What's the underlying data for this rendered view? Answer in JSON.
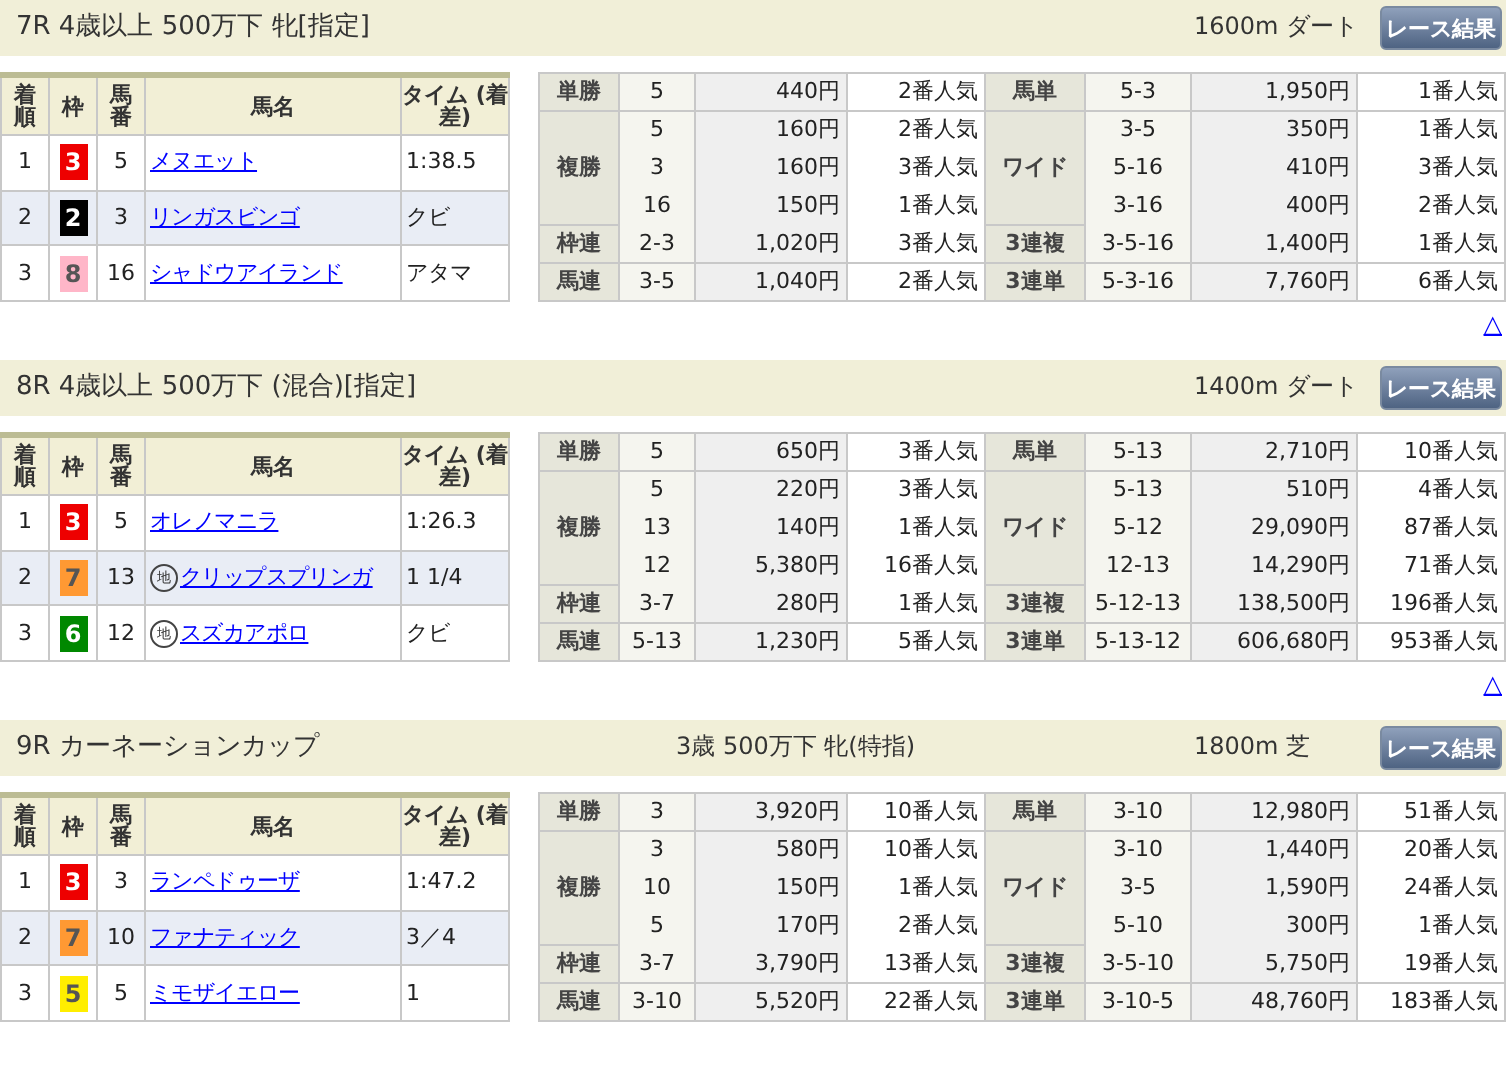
{
  "races": [
    {
      "title": "7R 4歳以上 500万下 牝[指定]",
      "course": "1600m ダート",
      "button": "レース結果",
      "columns": [
        "着順",
        "枠",
        "馬番",
        "馬名",
        "タイム (着差)"
      ],
      "results": [
        {
          "place": "1",
          "waku": "3",
          "color": "#ee0000",
          "number": "5",
          "name": "メヌエット",
          "time": "1:38.5"
        },
        {
          "place": "2",
          "waku": "2",
          "color": "#000000",
          "number": "3",
          "name": "リンガスビンゴ",
          "time": "クビ"
        },
        {
          "place": "3",
          "waku": "8",
          "color": "#ffb6c8",
          "number": "16",
          "name": "シャドウアイランド",
          "time": "アタマ"
        }
      ],
      "payouts_left": [
        {
          "label": "単勝",
          "entries": [
            {
              "combo": "5",
              "amount": "440円",
              "popularity": "2番人気"
            }
          ]
        },
        {
          "label": "複勝",
          "entries": [
            {
              "combo": "5",
              "amount": "160円",
              "popularity": "2番人気"
            },
            {
              "combo": "3",
              "amount": "160円",
              "popularity": "3番人気"
            },
            {
              "combo": "16",
              "amount": "150円",
              "popularity": "1番人気"
            }
          ]
        },
        {
          "label": "枠連",
          "entries": [
            {
              "combo": "2-3",
              "amount": "1,020円",
              "popularity": "3番人気"
            }
          ]
        },
        {
          "label": "馬連",
          "entries": [
            {
              "combo": "3-5",
              "amount": "1,040円",
              "popularity": "2番人気"
            }
          ]
        }
      ],
      "payouts_right": [
        {
          "label": "馬単",
          "entries": [
            {
              "combo": "5-3",
              "amount": "1,950円",
              "popularity": "1番人気"
            }
          ]
        },
        {
          "label": "ワイド",
          "entries": [
            {
              "combo": "3-5",
              "amount": "350円",
              "popularity": "1番人気"
            },
            {
              "combo": "5-16",
              "amount": "410円",
              "popularity": "3番人気"
            },
            {
              "combo": "3-16",
              "amount": "400円",
              "popularity": "2番人気"
            }
          ]
        },
        {
          "label": "3連複",
          "entries": [
            {
              "combo": "3-5-16",
              "amount": "1,400円",
              "popularity": "1番人気"
            }
          ]
        },
        {
          "label": "3連単",
          "entries": [
            {
              "combo": "5-3-16",
              "amount": "7,760円",
              "popularity": "6番人気"
            }
          ]
        }
      ],
      "back_link": "△"
    },
    {
      "title": "8R 4歳以上 500万下 (混合)[指定]",
      "course": "1400m ダート",
      "button": "レース結果",
      "columns": [
        "着順",
        "枠",
        "馬番",
        "馬名",
        "タイム (着差)"
      ],
      "results": [
        {
          "place": "1",
          "waku": "3",
          "color": "#ee0000",
          "number": "5",
          "name": "オレノマニラ",
          "time": "1:26.3"
        },
        {
          "place": "2",
          "waku": "7",
          "color": "#ff9933",
          "number": "13",
          "marker": "地",
          "name": "クリップスプリンガ",
          "time": "1 1/4"
        },
        {
          "place": "3",
          "waku": "6",
          "color": "#008800",
          "number": "12",
          "marker": "地",
          "name": "スズカアポロ",
          "time": "クビ"
        }
      ],
      "payouts_left": [
        {
          "label": "単勝",
          "entries": [
            {
              "combo": "5",
              "amount": "650円",
              "popularity": "3番人気"
            }
          ]
        },
        {
          "label": "複勝",
          "entries": [
            {
              "combo": "5",
              "amount": "220円",
              "popularity": "3番人気"
            },
            {
              "combo": "13",
              "amount": "140円",
              "popularity": "1番人気"
            },
            {
              "combo": "12",
              "amount": "5,380円",
              "popularity": "16番人気"
            }
          ]
        },
        {
          "label": "枠連",
          "entries": [
            {
              "combo": "3-7",
              "amount": "280円",
              "popularity": "1番人気"
            }
          ]
        },
        {
          "label": "馬連",
          "entries": [
            {
              "combo": "5-13",
              "amount": "1,230円",
              "popularity": "5番人気"
            }
          ]
        }
      ],
      "payouts_right": [
        {
          "label": "馬単",
          "entries": [
            {
              "combo": "5-13",
              "amount": "2,710円",
              "popularity": "10番人気"
            }
          ]
        },
        {
          "label": "ワイド",
          "entries": [
            {
              "combo": "5-13",
              "amount": "510円",
              "popularity": "4番人気"
            },
            {
              "combo": "5-12",
              "amount": "29,090円",
              "popularity": "87番人気"
            },
            {
              "combo": "12-13",
              "amount": "14,290円",
              "popularity": "71番人気"
            }
          ]
        },
        {
          "label": "3連複",
          "entries": [
            {
              "combo": "5-12-13",
              "amount": "138,500円",
              "popularity": "196番人気"
            }
          ]
        },
        {
          "label": "3連単",
          "entries": [
            {
              "combo": "5-13-12",
              "amount": "606,680円",
              "popularity": "953番人気"
            }
          ]
        }
      ],
      "back_link": "△"
    },
    {
      "title": "9R カーネーションカップ",
      "subtitle": "3歳 500万下 牝(特指)",
      "course": "1800m 芝",
      "button": "レース結果",
      "columns": [
        "着順",
        "枠",
        "馬番",
        "馬名",
        "タイム (着差)"
      ],
      "results": [
        {
          "place": "1",
          "waku": "3",
          "color": "#ee0000",
          "number": "3",
          "name": "ランペドゥーザ",
          "time": "1:47.2"
        },
        {
          "place": "2",
          "waku": "7",
          "color": "#ff9933",
          "number": "10",
          "name": "ファナティック",
          "time": "3／4"
        },
        {
          "place": "3",
          "waku": "5",
          "color": "#ffee00",
          "number": "5",
          "name": "ミモザイエロー",
          "time": "1"
        }
      ],
      "payouts_left": [
        {
          "label": "単勝",
          "entries": [
            {
              "combo": "3",
              "amount": "3,920円",
              "popularity": "10番人気"
            }
          ]
        },
        {
          "label": "複勝",
          "entries": [
            {
              "combo": "3",
              "amount": "580円",
              "popularity": "10番人気"
            },
            {
              "combo": "10",
              "amount": "150円",
              "popularity": "1番人気"
            },
            {
              "combo": "5",
              "amount": "170円",
              "popularity": "2番人気"
            }
          ]
        },
        {
          "label": "枠連",
          "entries": [
            {
              "combo": "3-7",
              "amount": "3,790円",
              "popularity": "13番人気"
            }
          ]
        },
        {
          "label": "馬連",
          "entries": [
            {
              "combo": "3-10",
              "amount": "5,520円",
              "popularity": "22番人気"
            }
          ]
        }
      ],
      "payouts_right": [
        {
          "label": "馬単",
          "entries": [
            {
              "combo": "3-10",
              "amount": "12,980円",
              "popularity": "51番人気"
            }
          ]
        },
        {
          "label": "ワイド",
          "entries": [
            {
              "combo": "3-10",
              "amount": "1,440円",
              "popularity": "20番人気"
            },
            {
              "combo": "3-5",
              "amount": "1,590円",
              "popularity": "24番人気"
            },
            {
              "combo": "5-10",
              "amount": "300円",
              "popularity": "1番人気"
            }
          ]
        },
        {
          "label": "3連複",
          "entries": [
            {
              "combo": "3-5-10",
              "amount": "5,750円",
              "popularity": "19番人気"
            }
          ]
        },
        {
          "label": "3連単",
          "entries": [
            {
              "combo": "3-10-5",
              "amount": "48,760円",
              "popularity": "183番人気"
            }
          ]
        }
      ]
    }
  ]
}
